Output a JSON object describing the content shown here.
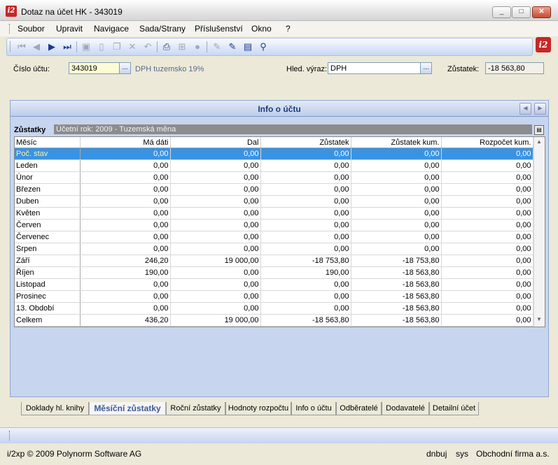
{
  "window": {
    "title": "Dotaz na účet HK - 343019",
    "app_icon_text": "i2",
    "controls": {
      "minimize": "_",
      "maximize": "□",
      "close": "✕"
    }
  },
  "menu": [
    "Soubor",
    "Upravit",
    "Navigace",
    "Sada/Strany",
    "Příslušenství",
    "Okno",
    "?"
  ],
  "toolbar": {
    "icons": [
      "first-record-icon",
      "previous-record-icon",
      "next-record-icon",
      "last-record-icon",
      "save-icon",
      "new-document-icon",
      "copy-icon",
      "delete-icon",
      "undo-icon",
      "print-icon",
      "tree-icon",
      "circle-icon",
      "edit-pen-icon",
      "edit-pen-alt-icon",
      "document-export-icon",
      "filter-icon"
    ],
    "brand_logo": "i2"
  },
  "form": {
    "account_label": "Číslo účtu:",
    "account_value": "343019",
    "account_button": "...",
    "account_hint": "DPH tuzemsko 19%",
    "search_label": "Hled. výraz:",
    "search_value": "DPH",
    "search_button": "...",
    "balance_label": "Zůstatek:",
    "balance_value": "-18 563,80"
  },
  "panel": {
    "title": "Info o účtu",
    "section_label": "Zůstatky",
    "section_info": "Účetní rok: 2009  -  Tuzemská měna",
    "columns": [
      "Měsíc",
      "Má dáti",
      "Dal",
      "Zůstatek",
      "Zůstatek kum.",
      "Rozpočet kum."
    ],
    "rows": [
      [
        "Poč. stav",
        "0,00",
        "0,00",
        "0,00",
        "0,00",
        "0,00"
      ],
      [
        "Leden",
        "0,00",
        "0,00",
        "0,00",
        "0,00",
        "0,00"
      ],
      [
        "Únor",
        "0,00",
        "0,00",
        "0,00",
        "0,00",
        "0,00"
      ],
      [
        "Březen",
        "0,00",
        "0,00",
        "0,00",
        "0,00",
        "0,00"
      ],
      [
        "Duben",
        "0,00",
        "0,00",
        "0,00",
        "0,00",
        "0,00"
      ],
      [
        "Květen",
        "0,00",
        "0,00",
        "0,00",
        "0,00",
        "0,00"
      ],
      [
        "Červen",
        "0,00",
        "0,00",
        "0,00",
        "0,00",
        "0,00"
      ],
      [
        "Červenec",
        "0,00",
        "0,00",
        "0,00",
        "0,00",
        "0,00"
      ],
      [
        "Srpen",
        "0,00",
        "0,00",
        "0,00",
        "0,00",
        "0,00"
      ],
      [
        "Září",
        "246,20",
        "19 000,00",
        "-18 753,80",
        "-18 753,80",
        "0,00"
      ],
      [
        "Říjen",
        "190,00",
        "0,00",
        "190,00",
        "-18 563,80",
        "0,00"
      ],
      [
        "Listopad",
        "0,00",
        "0,00",
        "0,00",
        "-18 563,80",
        "0,00"
      ],
      [
        "Prosinec",
        "0,00",
        "0,00",
        "0,00",
        "-18 563,80",
        "0,00"
      ],
      [
        "13. Období",
        "0,00",
        "0,00",
        "0,00",
        "-18 563,80",
        "0,00"
      ],
      [
        "Celkem",
        "436,20",
        "19 000,00",
        "-18 563,80",
        "-18 563,80",
        "0,00"
      ]
    ],
    "selected_row": 0
  },
  "tabs": [
    "Doklady hl. knihy",
    "Měsíční zůstatky",
    "Roční zůstatky",
    "Hodnoty rozpočtu",
    "Info o účtu",
    "Odběratelé",
    "Dodavatelé",
    "Detailní účet"
  ],
  "active_tab": 1,
  "footer": {
    "copyright": "i/2xp © 2009 Polynorm Software AG",
    "user": "dnbuj",
    "db": "sys",
    "company": "Obchodní firma a.s."
  }
}
